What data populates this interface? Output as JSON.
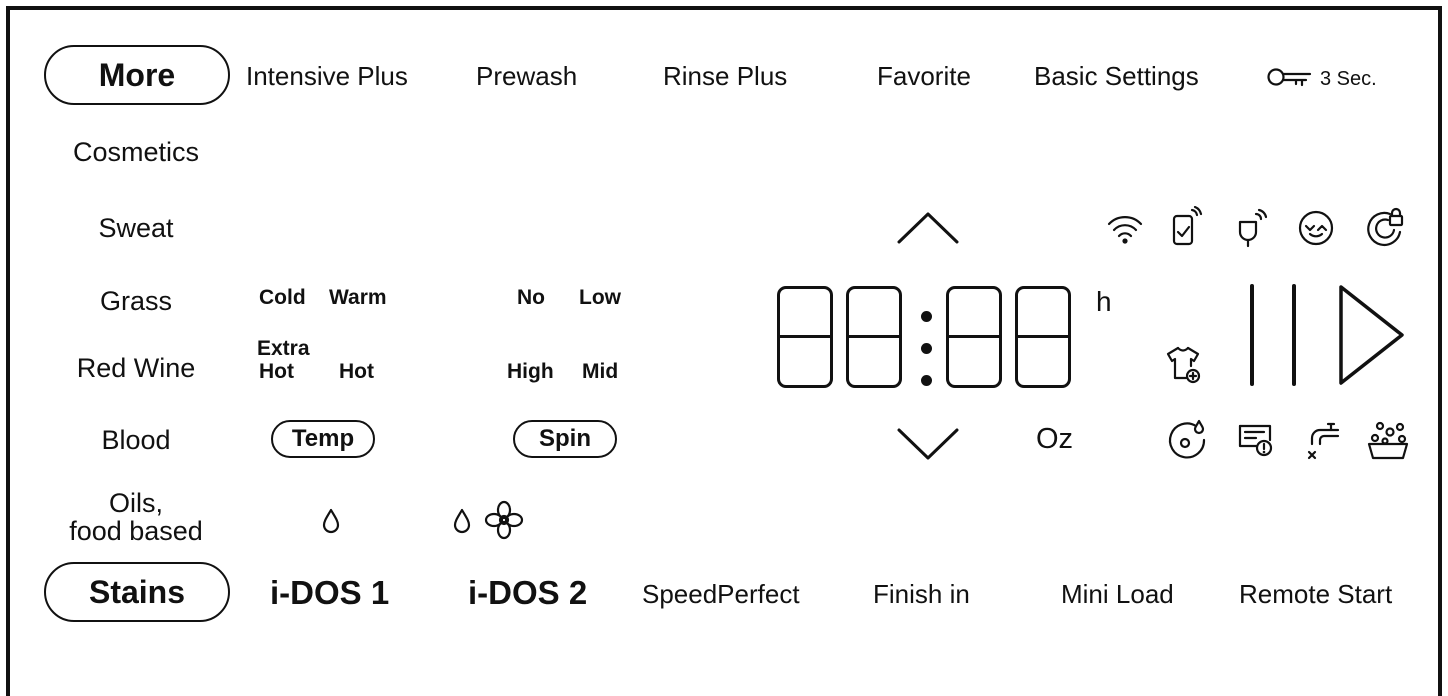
{
  "options_row": {
    "more": "More",
    "intensive_plus": "Intensive Plus",
    "prewash": "Prewash",
    "rinse_plus": "Rinse Plus",
    "favorite": "Favorite",
    "basic_settings": "Basic Settings",
    "lock_hint": "3 Sec."
  },
  "stains_list": [
    "Cosmetics",
    "Sweat",
    "Grass",
    "Red Wine",
    "Blood"
  ],
  "stains_oils_line1": "Oils,",
  "stains_oils_line2": "food based",
  "temp": {
    "cold": "Cold",
    "warm": "Warm",
    "extra_hot_1": "Extra",
    "extra_hot_2": "Hot",
    "hot": "Hot",
    "button": "Temp"
  },
  "spin": {
    "no": "No",
    "low": "Low",
    "high": "High",
    "mid": "Mid",
    "button": "Spin"
  },
  "display": {
    "hours_unit": "h",
    "weight_unit": "Oz"
  },
  "bottom_row": {
    "stains": "Stains",
    "idos1": "i-DOS 1",
    "idos2": "i-DOS 2",
    "speed_perfect": "SpeedPerfect",
    "finish_in": "Finish in",
    "mini_load": "Mini Load",
    "remote_start": "Remote Start"
  }
}
